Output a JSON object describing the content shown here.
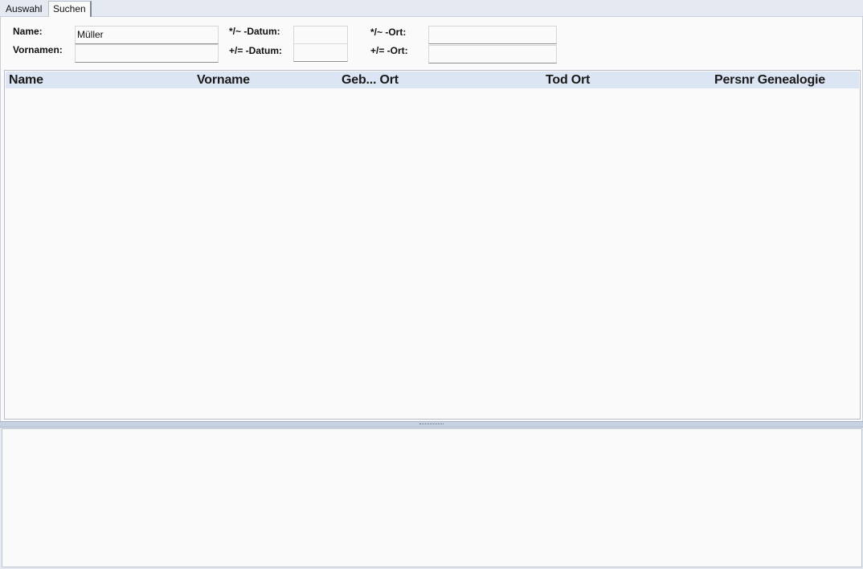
{
  "tabs": [
    {
      "label": "Auswahl"
    },
    {
      "label": "Suchen"
    }
  ],
  "search": {
    "name_label": "Name:",
    "name_value": "Müller",
    "vornamen_label": "Vornamen:",
    "vornamen_value": "",
    "birth_date_label": "*/~ -Datum:",
    "birth_date_value": "",
    "death_date_label": "+/= -Datum:",
    "death_date_value": "",
    "birth_place_label": "*/~ -Ort:",
    "birth_place_value": "",
    "death_place_label": "+/= -Ort:",
    "death_place_value": ""
  },
  "table": {
    "columns": [
      "Name",
      "Vorname",
      "Geb... Ort",
      "Tod Ort",
      "Persnr Genealogie"
    ],
    "rows": []
  }
}
